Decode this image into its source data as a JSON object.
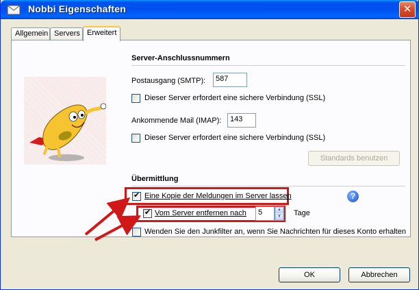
{
  "window": {
    "title": "Nobbi Eigenschaften",
    "close_glyph": "✕"
  },
  "tabs": [
    {
      "label": "Allgemein"
    },
    {
      "label": "Servers"
    },
    {
      "label": "Erweitert",
      "active": true
    }
  ],
  "server_ports": {
    "heading": "Server-Anschlussnummern",
    "smtp_label": "Postausgang (SMTP):",
    "smtp_value": "587",
    "smtp_ssl_label": "Dieser Server erfordert eine sichere Verbindung (SSL)",
    "smtp_ssl_checked": false,
    "imap_label": "Ankommende Mail (IMAP):",
    "imap_value": "143",
    "imap_ssl_label": "Dieser Server erfordert eine sichere Verbindung (SSL)",
    "imap_ssl_checked": false,
    "defaults_button": "Standards benutzen"
  },
  "delivery": {
    "heading": "Übermittlung",
    "keep_copy_label": "Eine Kopie der Meldungen im Server lassen",
    "keep_copy_checked": true,
    "remove_after_label": "Vom Server entfernen nach",
    "remove_after_checked": true,
    "remove_after_days": "5",
    "days_label": "Tage",
    "junk_label": "Wenden Sie den Junkfilter an, wenn Sie Nachrichten für dieses Konto erhalten",
    "junk_checked": false,
    "help_glyph": "?"
  },
  "buttons": {
    "ok": "OK",
    "cancel": "Abbrechen"
  },
  "colors": {
    "titlebar": "#0053ee",
    "highlight": "#d01818",
    "arrow": "#d01818"
  },
  "icons": [
    "mascot-icon",
    "help-icon",
    "close-icon",
    "arrow-icon"
  ]
}
